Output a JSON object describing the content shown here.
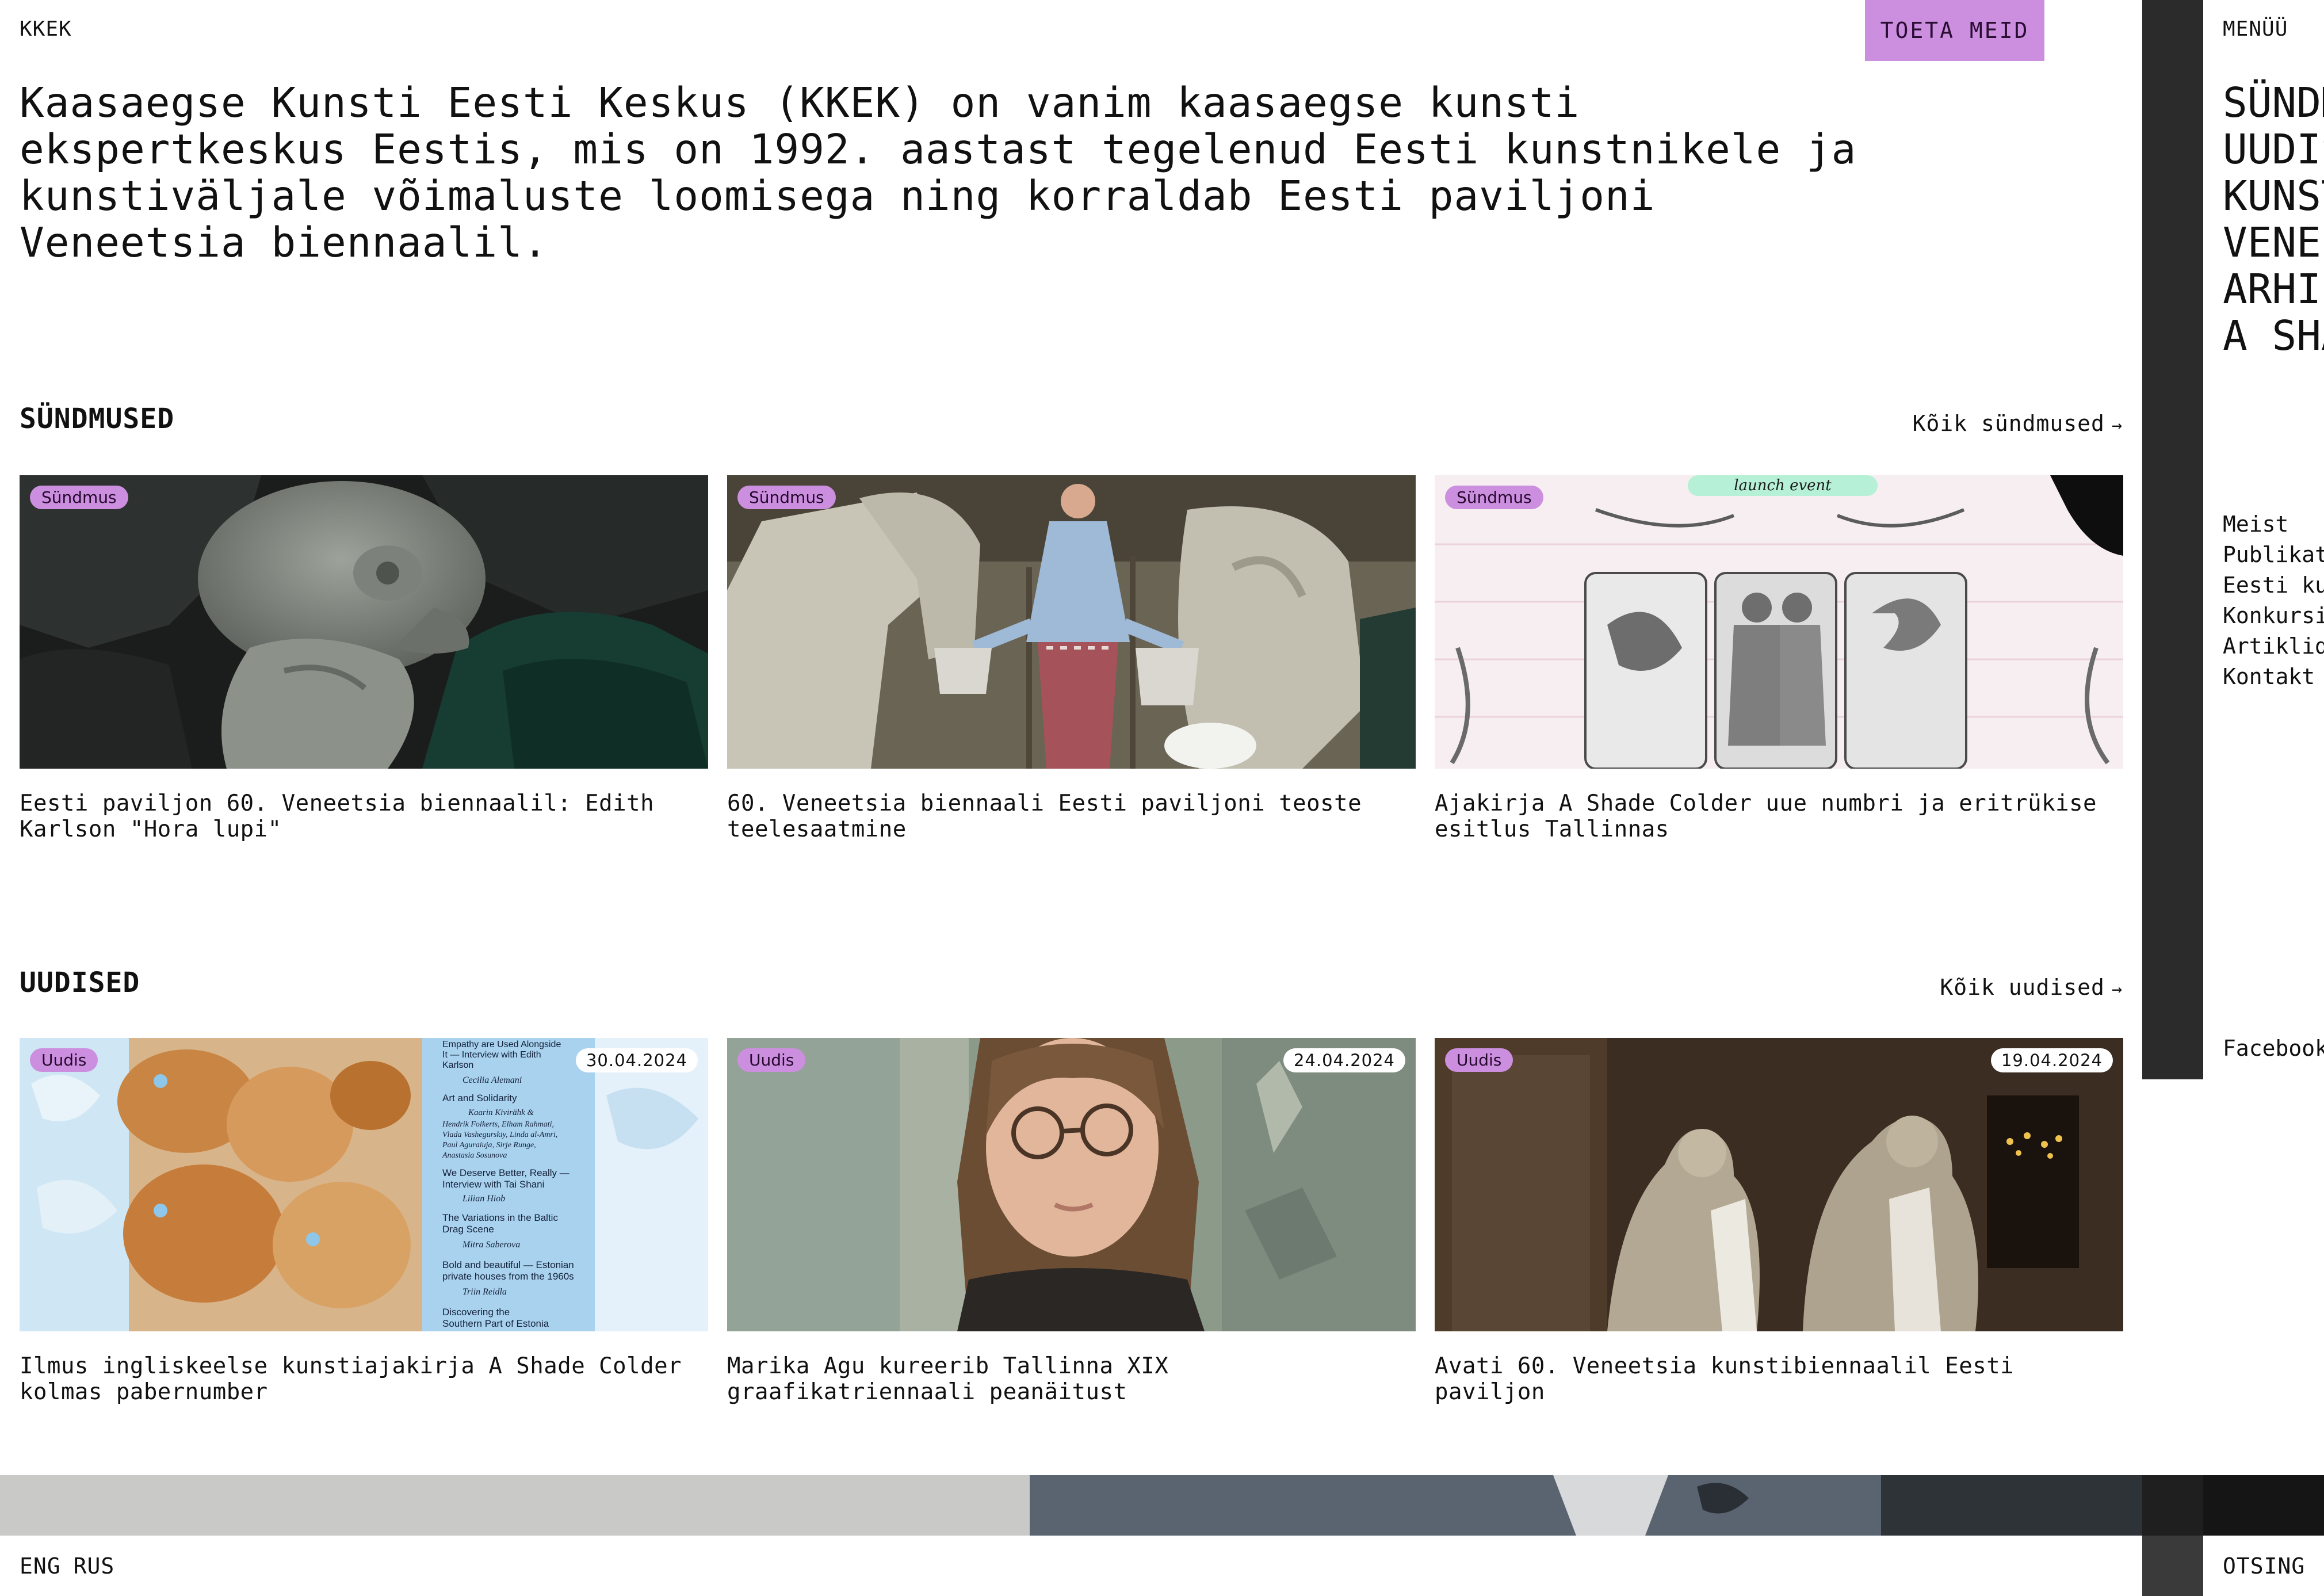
{
  "header": {
    "logo": "KKEK",
    "support_button": "TOETA MEID"
  },
  "intro": {
    "text": "Kaasaegse Kunsti Eesti Keskus (KKEK) on vanim kaasaegse kunsti ekspertkeskus Eestis, mis on 1992. aastast tegelenud Eesti kunstnikele ja kunstiväljale võimaluste loomisega ning korraldab Eesti paviljoni Veneetsia biennaalil."
  },
  "events": {
    "title": "SÜNDMUSED",
    "all_link": "Kõik sündmused",
    "items": [
      {
        "tag": "Sündmus",
        "title": "Eesti paviljon 60. Veneetsia biennaalil: Edith Karlson \"Hora lupi\"",
        "image": "fish-sculpture"
      },
      {
        "tag": "Sündmus",
        "title": "60. Veneetsia biennaali Eesti paviljoni teoste teelesaatmine",
        "image": "woman-with-buckets"
      },
      {
        "tag": "Sündmus",
        "title": "Ajakirja A Shade Colder uue numbri ja eritrükise esitlus Tallinnas",
        "image": "launch-event-poster",
        "image_text": "launch event"
      }
    ]
  },
  "news": {
    "title": "UUDISED",
    "all_link": "Kõik uudised",
    "items": [
      {
        "tag": "Uudis",
        "date": "30.04.2024",
        "title": "Ilmus ingliskeelse kunstiajakirja A Shade Colder kolmas pabernumber",
        "image": "magazine-cover",
        "image_lines": [
          "Empathy are Used Alongside",
          "It — Interview with Edith",
          "Karlson",
          "Cecilia Alemani",
          "Art and Solidarity",
          "Kaarin Kivirähk &",
          "Hendrik Folkerts, Elham Rahmati,",
          "Vlada Vashegurskiy, Linda al-Amri,",
          "Paul Aguraiuja, Sirje Runge,",
          "Anastasia Sosunova",
          "We Deserve Better, Really —",
          "Interview with Tai Shani",
          "Lilian Hiob",
          "The Variations in the Baltic",
          "Drag Scene",
          "Mitra Saberova",
          "Bold and beautiful — Estonian",
          "private houses from the 1960s",
          "Triin Reidla",
          "Discovering the",
          "Southern Part of Estonia"
        ]
      },
      {
        "tag": "Uudis",
        "date": "24.04.2024",
        "title": "Marika Agu kureerib Tallinna XIX graafikatriennaali peanäitust",
        "image": "portrait-woman-glasses"
      },
      {
        "tag": "Uudis",
        "date": "19.04.2024",
        "title": "Avati 60. Veneetsia kunstibiennaalil Eesti paviljon",
        "image": "two-sculptures"
      }
    ]
  },
  "footer": {
    "languages": [
      "ENG",
      "RUS"
    ]
  },
  "menu": {
    "label": "MENÜÜ",
    "main_items": [
      "SÜNDM",
      "UUDIS",
      "KUNST",
      "VENEE",
      "ARHII",
      "A SHA"
    ],
    "sub_items": [
      "Meist",
      "Publikat",
      "Eesti ku",
      "Konkursi",
      "Artiklid",
      "Kontakt"
    ],
    "social": "Facebook",
    "search": "OTSING"
  },
  "colors": {
    "accent": "#cc8fdf",
    "text": "#111111",
    "background": "#ffffff"
  }
}
